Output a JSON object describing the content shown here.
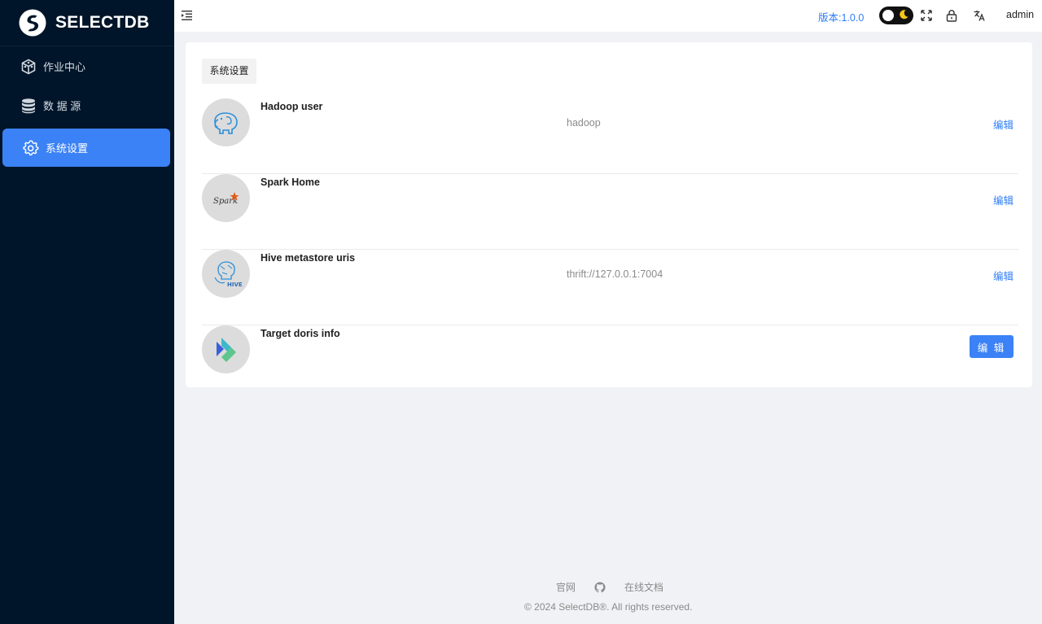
{
  "brand": {
    "name": "SELECTDB"
  },
  "sidebar": {
    "items": [
      {
        "label": "作业中心",
        "icon": "cube-network-icon"
      },
      {
        "label": "数 据 源",
        "icon": "database-icon"
      },
      {
        "label": "系统设置",
        "icon": "gear-icon",
        "active": true
      }
    ]
  },
  "header": {
    "version": "版本:1.0.0",
    "user": "admin",
    "icons": [
      "menu-collapse-icon",
      "theme-toggle",
      "fullscreen-icon",
      "lock-icon",
      "translate-icon"
    ]
  },
  "settings": {
    "tab": "系统设置",
    "rows": [
      {
        "title": "Hadoop user",
        "value": "hadoop",
        "edit": "编辑",
        "icon": "hadoop-elephant-icon"
      },
      {
        "title": "Spark Home",
        "value": "",
        "edit": "编辑",
        "icon": "spark-logo-icon"
      },
      {
        "title": "Hive metastore uris",
        "value": "thrift://127.0.0.1:7004",
        "edit": "编辑",
        "icon": "hive-logo-icon"
      },
      {
        "title": "Target doris info",
        "value": "",
        "edit": "编 辑",
        "icon": "doris-logo-icon"
      }
    ]
  },
  "footer": {
    "links": [
      "官网",
      "在线文档"
    ],
    "copyright": "© 2024 SelectDB®. All rights reserved."
  },
  "colors": {
    "sidebar_bg": "#001529",
    "accent": "#3b82f6",
    "link": "#2f7df6",
    "page_bg": "#f0f2f5"
  }
}
